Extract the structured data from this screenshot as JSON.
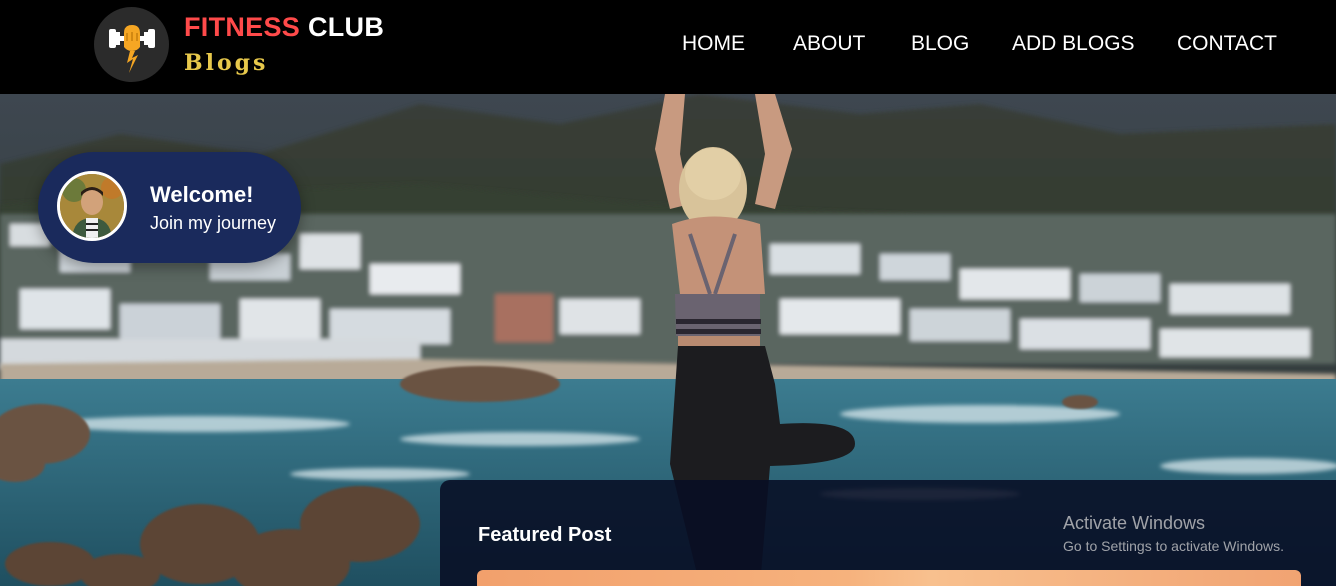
{
  "brand": {
    "title_part1": "FITNESS",
    "title_part2": "CLUB",
    "subtitle": "Blogs"
  },
  "nav": {
    "items": [
      {
        "label": "HOME"
      },
      {
        "label": "ABOUT"
      },
      {
        "label": "BLOG"
      },
      {
        "label": "ADD BLOGS"
      },
      {
        "label": "CONTACT"
      }
    ]
  },
  "welcome": {
    "title": "Welcome!",
    "subtitle": "Join my journey"
  },
  "featured": {
    "title": "Featured Post"
  },
  "watermark": {
    "title": "Activate Windows",
    "subtitle": "Go to Settings to activate Windows."
  },
  "colors": {
    "navbar_bg": "#000000",
    "brand_red": "#ff4a4a",
    "brand_gold": "#e7c84b",
    "welcome_bg": "#1a2a5c",
    "featured_bg": "#080e24"
  }
}
